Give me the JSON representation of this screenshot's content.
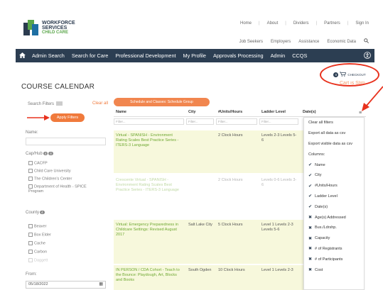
{
  "logo": {
    "line1": "WORKFORCE",
    "line2": "SERVICES",
    "line3": "CHILD CARE"
  },
  "toplinks": [
    "Home",
    "About",
    "Dividers",
    "Partners",
    "Sign In"
  ],
  "sublinks": [
    "Job Seekers",
    "Employers",
    "Assistance",
    "Economic Data"
  ],
  "search_icon": "search-icon",
  "nav": {
    "items": [
      "Admin Search",
      "Search for Care",
      "Professional Development",
      "My Profile",
      "Approvals Processing",
      "Admin",
      "CCQS"
    ],
    "home_icon": "home-icon",
    "accessibility_icon": "accessibility-icon"
  },
  "checkout": {
    "count": "0",
    "label": "CHECKOUT"
  },
  "cart_note": "Cart is Slim",
  "page_title": "COURSE CALENDAR",
  "filters": {
    "header": "Search Filters",
    "clear_all": "Clear all",
    "apply": "Apply Filters",
    "name_label": "Name:",
    "cap_label": "Cap/Hub",
    "cap_counts": [
      "4",
      "4"
    ],
    "cap_options": [
      "CACFP",
      "Child Care University",
      "The Children's Center",
      "Department of Health - SPICE Program"
    ],
    "county_label": "County",
    "county_count": "4",
    "county_options": [
      "Beaver",
      "Box Elder",
      "Cache",
      "Carbon",
      "Daggett"
    ],
    "from_label": "From:",
    "from_value": "05/18/2022"
  },
  "group_button": "Schedule and Classes: Schedule Group",
  "grid": {
    "columns": [
      "Name",
      "City",
      "#Units/Hours",
      "Ladder Level",
      "Date(s)"
    ],
    "filter_placeholder": "Filter...",
    "rows": [
      {
        "name": "Virtual - SPANISH - Environment Rating Scales Best Practice Series - ITERS-3 Language",
        "city": "",
        "units": "2 Clock Hours",
        "level": "Levels 2-3 Levels 5-6"
      },
      {
        "name": "Crescente Virtual - SPANISH - Environment Rating Scales Best Practice Series - ITERS-3 Language",
        "city": "",
        "units": "2 Clock Hours",
        "level": "Levels 0-6 Levels 3-6"
      },
      {
        "name": "Virtual: Emergency Preparedness in Childcare Settings: Revised August 2017",
        "city": "Salt Lake City",
        "units": "5 Clock Hours",
        "level": "Level 1 Levels 2-3 Levels 5-6"
      },
      {
        "name": "IN PERSON / CDA Cohort - Teach to the Bounce: Playdough, Art, Blocks and Books",
        "city": "South Ogden",
        "units": "10 Clock Hours",
        "level": "Level 1 Levels 2-3"
      }
    ]
  },
  "column_menu": {
    "actions": [
      "Clear all filters",
      "Export all data as csv",
      "Export visible data as csv",
      "Columns:"
    ],
    "columns": [
      {
        "label": "Name",
        "visible": true
      },
      {
        "label": "City",
        "visible": true
      },
      {
        "label": "#Units/Hours",
        "visible": true
      },
      {
        "label": "Ladder Level",
        "visible": true
      },
      {
        "label": "Date(s)",
        "visible": true
      },
      {
        "label": "Age(s) Addressed",
        "visible": false
      },
      {
        "label": "Bus./Ldrshp.",
        "visible": false
      },
      {
        "label": "Capacity",
        "visible": false
      },
      {
        "label": "# of Registrants",
        "visible": false
      },
      {
        "label": "# of Participants",
        "visible": false
      },
      {
        "label": "Cost",
        "visible": false
      }
    ]
  },
  "colors": {
    "navy": "#2c3e52",
    "orange": "#f07a3c",
    "annotation_red": "#e8321e",
    "link_green": "#6fa832"
  }
}
